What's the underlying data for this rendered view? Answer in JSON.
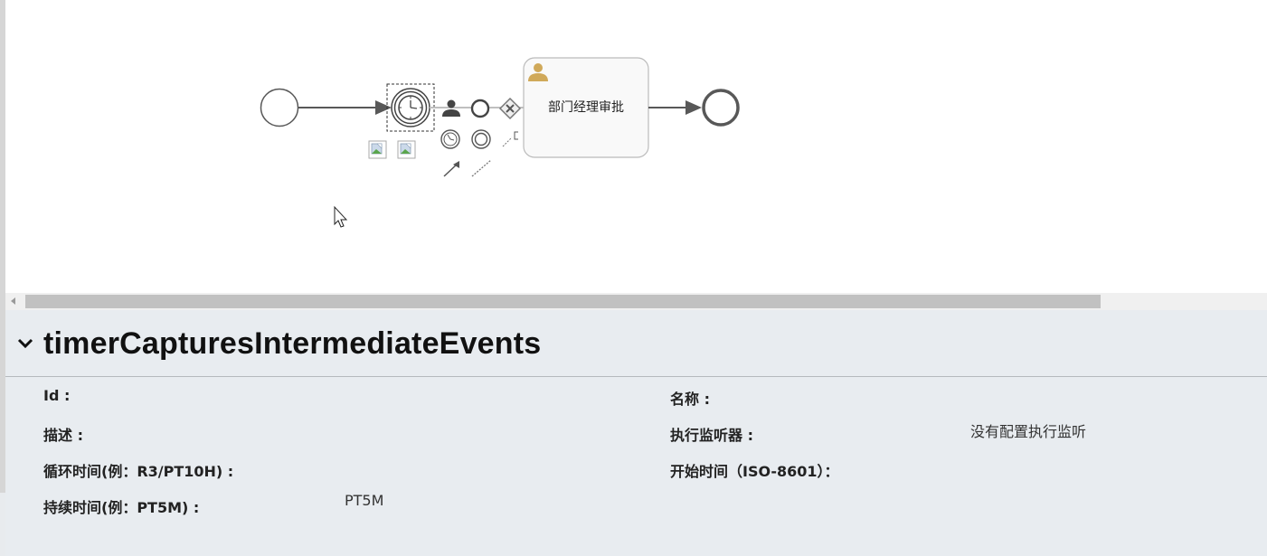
{
  "diagram": {
    "task_label": "部门经理审批"
  },
  "cursor": {
    "icon": "mouse-pointer-icon"
  },
  "palette": {
    "icons": [
      "user-task-icon",
      "end-event-icon",
      "exclusive-gateway-icon",
      "timer-event-icon",
      "intermediate-event-icon",
      "sequence-flow-icon",
      "association-icon",
      "text-annotation-icon",
      "delete-image-icon",
      "change-type-image-icon"
    ]
  },
  "properties": {
    "title": "timerCapturesIntermediateEvents",
    "fields": {
      "id": {
        "label": "Id :",
        "value": ""
      },
      "name": {
        "label": "名称 :",
        "value": ""
      },
      "description": {
        "label": "描述 :",
        "value": ""
      },
      "listeners": {
        "label": "执行监听器 :",
        "value": "没有配置执行监听"
      },
      "cycle": {
        "label": "循环时间(例：R3/PT10H) :",
        "value": ""
      },
      "start": {
        "label": "开始时间（ISO-8601）：",
        "value": ""
      },
      "duration": {
        "label": "持续时间(例：PT5M) :",
        "value": "PT5M"
      }
    }
  },
  "colors": {
    "panel_bg": "#e8ecf0",
    "task_icon": "#d0a95a",
    "flow": "#585858"
  }
}
